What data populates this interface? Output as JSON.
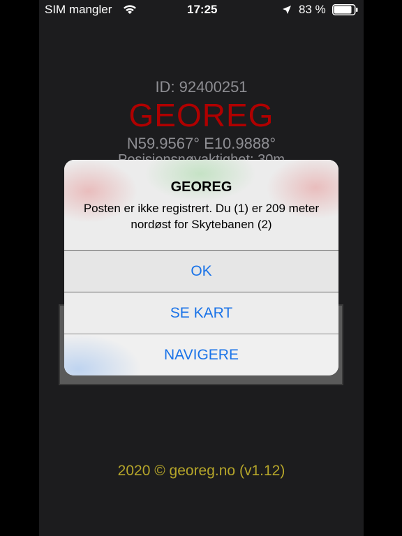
{
  "status_bar": {
    "carrier": "SIM mangler",
    "time": "17:25",
    "battery_percent": "83 %",
    "icons": [
      "wifi-icon",
      "location-arrow-icon",
      "battery-icon"
    ]
  },
  "main": {
    "id_text": "ID: 92400251",
    "title": "GEOREG",
    "coordinates": "N59.9567° E10.9888°",
    "accuracy": "Posisjonsnøyaktighet: 30m",
    "footer": "2020 © georeg.no (v1.12)"
  },
  "alert": {
    "title": "GEOREG",
    "message": "Posten er ikke registrert. Du (1) er 209 meter nordøst for Skytebanen (2)",
    "buttons": {
      "ok": "OK",
      "see_map": "SE KART",
      "navigate": "NAVIGERE"
    }
  },
  "colors": {
    "title_red": "#b00000",
    "footer_yellow": "#b5a52a",
    "ios_blue": "#1a73e8"
  }
}
